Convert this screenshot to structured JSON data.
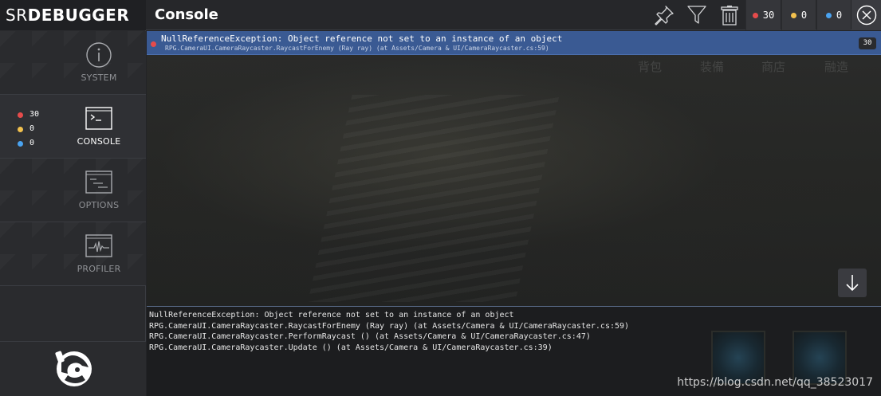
{
  "logo": {
    "part1": "SR",
    "part2": "DEBUGGER"
  },
  "header": {
    "title": "Console",
    "counts": {
      "error": "30",
      "warning": "0",
      "info": "0"
    }
  },
  "colors": {
    "error": "#e64b4b",
    "warning": "#f2c14e",
    "info": "#4aa3f0",
    "selected_row": "#3a5a93"
  },
  "sidebar": {
    "items": [
      {
        "label": "SYSTEM",
        "icon": "info-icon"
      },
      {
        "label": "CONSOLE",
        "icon": "terminal-icon"
      },
      {
        "label": "OPTIONS",
        "icon": "options-icon"
      },
      {
        "label": "PROFILER",
        "icon": "profiler-icon"
      }
    ],
    "counts": {
      "error": "30",
      "warning": "0",
      "info": "0"
    }
  },
  "log": {
    "entries": [
      {
        "message": "NullReferenceException: Object reference not set to an instance of an object",
        "trace": "RPG.CameraUI.CameraRaycaster.RaycastForEnemy (Ray ray) (at Assets/Camera & UI/CameraRaycaster.cs:59)",
        "count": "30"
      }
    ],
    "background_labels": [
      "背包",
      "装備",
      "商店",
      "融造"
    ]
  },
  "detail": {
    "lines": [
      "NullReferenceException: Object reference not set to an instance of an object",
      "RPG.CameraUI.CameraRaycaster.RaycastForEnemy (Ray ray) (at Assets/Camera & UI/CameraRaycaster.cs:59)",
      "RPG.CameraUI.CameraRaycaster.PerformRaycast () (at Assets/Camera & UI/CameraRaycaster.cs:47)",
      "RPG.CameraUI.CameraRaycaster.Update () (at Assets/Camera & UI/CameraRaycaster.cs:39)"
    ]
  },
  "watermark": "https://blog.csdn.net/qq_38523017"
}
